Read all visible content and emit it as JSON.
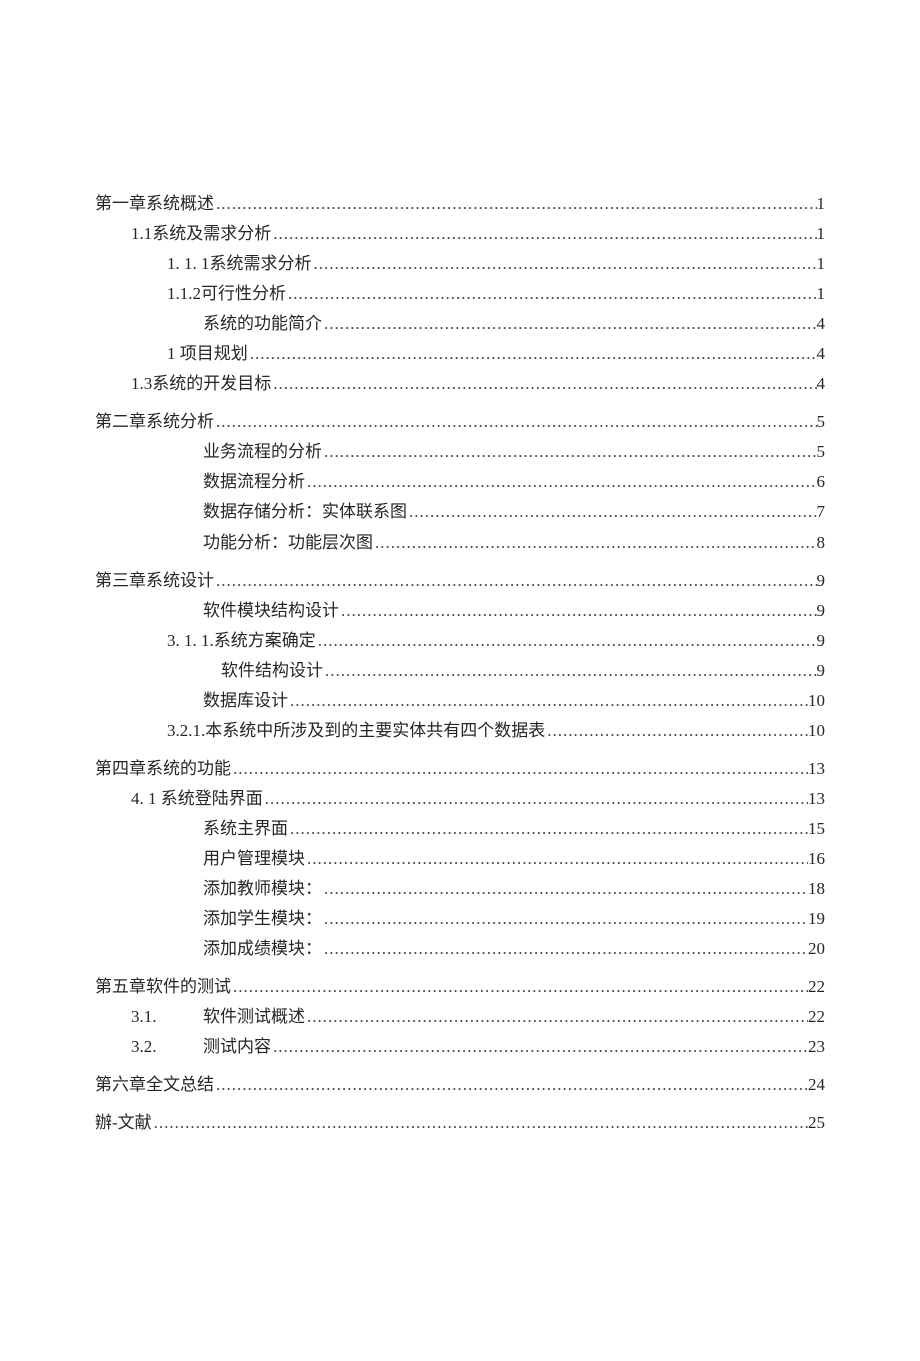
{
  "leader": "...........................................................................................................................................................................",
  "toc": [
    {
      "indent": 0,
      "title": "第一章系统概述",
      "page": "1",
      "gapBefore": false
    },
    {
      "indent": 1,
      "title": "1.1系统及需求分析",
      "page": "1",
      "gapBefore": false
    },
    {
      "indent": 2,
      "title": "1. 1. 1系统需求分析",
      "page": "1",
      "gapBefore": false
    },
    {
      "indent": 2,
      "title": "1.1.2可行性分析",
      "page": "1",
      "gapBefore": false
    },
    {
      "indent": 3,
      "title": "系统的功能简介",
      "page": "4",
      "gapBefore": false
    },
    {
      "indent": 2,
      "title": "1 项目规划",
      "page": "4",
      "gapBefore": false
    },
    {
      "indent": 1,
      "title": "1.3系统的开发目标",
      "page": "4",
      "gapBefore": false
    },
    {
      "indent": 0,
      "title": "第二章系统分析",
      "page": "5",
      "gapBefore": true
    },
    {
      "indent": 3,
      "title": "业务流程的分析",
      "page": "5",
      "gapBefore": false
    },
    {
      "indent": 3,
      "title": "数据流程分析",
      "page": "6",
      "gapBefore": false
    },
    {
      "indent": 3,
      "title": "数据存储分析：实体联系图",
      "page": "7",
      "gapBefore": false
    },
    {
      "indent": 3,
      "title": "功能分析：功能层次图",
      "page": "8",
      "gapBefore": false
    },
    {
      "indent": 0,
      "title": "第三章系统设计",
      "page": "9",
      "gapBefore": true
    },
    {
      "indent": 3,
      "title": "软件模块结构设计",
      "page": "9",
      "gapBefore": false
    },
    {
      "indent": 2,
      "title": "3. 1. 1.系统方案确定",
      "page": "9",
      "gapBefore": false
    },
    {
      "indent": 3,
      "titlePad": true,
      "title": "软件结构设计",
      "page": "9",
      "gapBefore": false
    },
    {
      "indent": 3,
      "title": "数据库设计",
      "page": "10",
      "gapBefore": false
    },
    {
      "indent": 2,
      "title": "3.2.1.本系统中所涉及到的主要实体共有四个数据表",
      "page": "10",
      "gapBefore": false
    },
    {
      "indent": 0,
      "title": "第四章系统的功能",
      "page": "13",
      "gapBefore": true
    },
    {
      "indent": 1,
      "title": "4. 1 系统登陆界面",
      "page": "13",
      "gapBefore": false
    },
    {
      "indent": 3,
      "title": "系统主界面",
      "page": "15",
      "gapBefore": false
    },
    {
      "indent": 3,
      "title": "用户管理模块",
      "page": "16",
      "gapBefore": false
    },
    {
      "indent": 3,
      "title": "添加教师模块：",
      "page": "18",
      "gapBefore": false
    },
    {
      "indent": 3,
      "title": "添加学生模块：",
      "page": "19",
      "gapBefore": false
    },
    {
      "indent": 3,
      "title": "添加成绩模块：",
      "page": "20",
      "gapBefore": false
    },
    {
      "indent": 0,
      "title": "第五章软件的测试",
      "page": "22",
      "gapBefore": true
    },
    {
      "indent": 1,
      "prefix": "3.1.",
      "title": "软件测试概述",
      "page": "22",
      "titleIndent": 3,
      "gapBefore": false
    },
    {
      "indent": 1,
      "prefix": "3.2.",
      "title": "测试内容",
      "page": "23",
      "titleIndent": 3,
      "gapBefore": false
    },
    {
      "indent": 0,
      "title": "第六章全文总结",
      "page": "24",
      "gapBefore": true
    },
    {
      "indent": 0,
      "title": "辦-文献",
      "page": "25",
      "gapBefore": true
    }
  ]
}
